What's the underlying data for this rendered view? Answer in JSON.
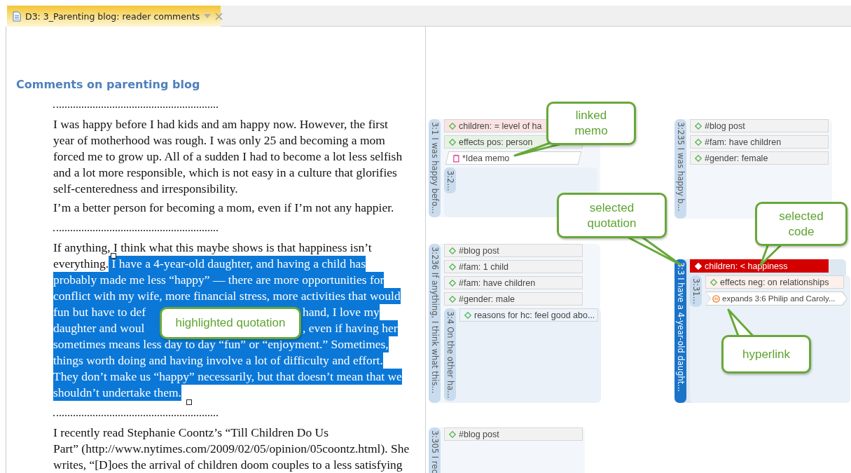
{
  "tab": {
    "label": "D3: 3_Parenting blog: reader comments",
    "selected": true
  },
  "document": {
    "heading": "Comments on parenting blog",
    "sections": [
      {
        "paragraphs": [
          {
            "lines": [
              {
                "covered": false,
                "segments": [
                  {
                    "text": "I was happy before I had kids and am happy now. However, the first",
                    "highlighted": false
                  }
                ]
              },
              {
                "covered": false,
                "segments": [
                  {
                    "text": "year of motherhood was rough. I was only 25 and becoming a mom",
                    "highlighted": false
                  }
                ]
              },
              {
                "covered": false,
                "segments": [
                  {
                    "text": "forced me to grow up. All of a sudden I had to become a lot less selfish",
                    "highlighted": false
                  }
                ]
              },
              {
                "covered": false,
                "segments": [
                  {
                    "text": "and a lot more responsible, which is not easy in a culture that glorifies",
                    "highlighted": false
                  }
                ]
              },
              {
                "covered": false,
                "segments": [
                  {
                    "text": "self-centeredness and irresponsibility.",
                    "highlighted": false
                  }
                ]
              }
            ]
          },
          {
            "lines": [
              {
                "covered": false,
                "segments": [
                  {
                    "text": "I’m a better person for becoming a mom, even if I’m not any happier.",
                    "highlighted": false
                  }
                ]
              }
            ]
          }
        ]
      },
      {
        "paragraphs": [
          {
            "lines": [
              {
                "covered": false,
                "segments": [
                  {
                    "text": "If anything, I think what this maybe shows is that happiness isn’t",
                    "highlighted": false
                  }
                ]
              },
              {
                "covered": false,
                "segments": [
                  {
                    "text": "everything.",
                    "highlighted": false
                  },
                  {
                    "text": " I have a 4-year-old daughter, and having a child has",
                    "highlighted": true
                  }
                ]
              },
              {
                "covered": false,
                "segments": [
                  {
                    "text": "probably made me less “happy” — there are more opportunities for",
                    "highlighted": true
                  }
                ]
              },
              {
                "covered": false,
                "segments": [
                  {
                    "text": "conflict with my wife, more financial stress, more activities that would",
                    "highlighted": true
                  }
                ]
              },
              {
                "covered": true,
                "segments": [
                  {
                    "text": "fun but have to def",
                    "highlighted": true
                  },
                  {
                    "text": "hand, I love my",
                    "highlighted": true
                  }
                ]
              },
              {
                "covered": true,
                "segments": [
                  {
                    "text": "daughter and woul",
                    "highlighted": true
                  },
                  {
                    "text": ", even if having her",
                    "highlighted": true
                  }
                ]
              },
              {
                "covered": false,
                "segments": [
                  {
                    "text": "sometimes means less day to day “fun” or “enjoyment.” Sometimes,",
                    "highlighted": true
                  }
                ]
              },
              {
                "covered": false,
                "segments": [
                  {
                    "text": "things worth doing and having involve a lot of difficulty and effort.",
                    "highlighted": true
                  }
                ]
              },
              {
                "covered": false,
                "segments": [
                  {
                    "text": "They don’t make us “happy” necessarily, but that doesn’t mean that we",
                    "highlighted": true
                  }
                ]
              },
              {
                "covered": false,
                "segments": [
                  {
                    "text": "shouldn’t undertake them.",
                    "highlighted": true
                  }
                ]
              }
            ]
          }
        ]
      },
      {
        "paragraphs": [
          {
            "lines": [
              {
                "covered": false,
                "segments": [
                  {
                    "text": "I recently read Stephanie Coontz’s “Till Children Do Us",
                    "highlighted": false
                  }
                ]
              },
              {
                "covered": false,
                "segments": [
                  {
                    "text": "Part” (http://www.nytimes.com/2009/02/05/opinion/05coontz.html). She",
                    "highlighted": false
                  }
                ]
              },
              {
                "covered": false,
                "segments": [
                  {
                    "text": "writes, “[D]oes the arrival of children doom couples to a less satisfying",
                    "highlighted": false
                  }
                ]
              }
            ]
          }
        ]
      }
    ]
  },
  "quotations": [
    {
      "label": "3:1 I was happy befo...",
      "selected": false,
      "codes": [
        {
          "kind": "code",
          "text": "children: = level of ha",
          "selected": false,
          "color": "#fbe3e3"
        },
        {
          "kind": "code",
          "text": "effects pos: person",
          "selected": false,
          "color": "#e7f2e4"
        },
        {
          "kind": "memo",
          "text": "*Idea memo"
        }
      ],
      "children": [
        {
          "label": "3:2...",
          "selected": false
        }
      ]
    },
    {
      "label": "3:235 I was happy b...",
      "selected": false,
      "codes": [
        {
          "kind": "code",
          "text": "#blog post",
          "selected": false,
          "color": "#f2f2f2"
        },
        {
          "kind": "code",
          "text": "#fam: have children",
          "selected": false,
          "color": "#f2f2f2"
        },
        {
          "kind": "code",
          "text": "#gender: female",
          "selected": false,
          "color": "#f2f2f2"
        }
      ]
    },
    {
      "label": "3:236 If anything, I think what this...",
      "selected": false,
      "codes": [
        {
          "kind": "code",
          "text": "#blog post",
          "selected": false,
          "color": "#f2f2f2"
        },
        {
          "kind": "code",
          "text": "#fam: 1 child",
          "selected": false,
          "color": "#f2f2f2"
        },
        {
          "kind": "code",
          "text": "#fam: have children",
          "selected": false,
          "color": "#f2f2f2"
        },
        {
          "kind": "code",
          "text": "#gender: male",
          "selected": false,
          "color": "#f2f2f2"
        }
      ],
      "children": [
        {
          "label": "3:4 On the other ha...",
          "selected": false,
          "codes": [
            {
              "kind": "code",
              "text": "reasons for hc: feel good abo...",
              "selected": false,
              "color": "#edf3fa"
            }
          ]
        }
      ]
    },
    {
      "label": "3:3 I have a 4-year-old daught...",
      "selected": true,
      "codes": [
        {
          "kind": "code",
          "text": "children: < happiness",
          "selected": true,
          "color": "#d40000"
        }
      ],
      "children": [
        {
          "label": "3:31...",
          "selected": false,
          "codes": [
            {
              "kind": "code",
              "text": "effects neg: on relationships",
              "selected": false,
              "color": "#fcf1ec"
            },
            {
              "kind": "link",
              "text": "expands 3:6 Philip and Caroly..."
            }
          ]
        }
      ]
    },
    {
      "label": "3:305 I rec",
      "selected": false,
      "codes": [
        {
          "kind": "code",
          "text": "#blog post",
          "selected": false,
          "color": "#f2f2f2"
        }
      ]
    }
  ],
  "callouts": [
    {
      "text": "linked memo"
    },
    {
      "text": "selected quotation"
    },
    {
      "text": "selected code"
    },
    {
      "text": "highlighted quotation"
    },
    {
      "text": "hyperlink"
    }
  ]
}
